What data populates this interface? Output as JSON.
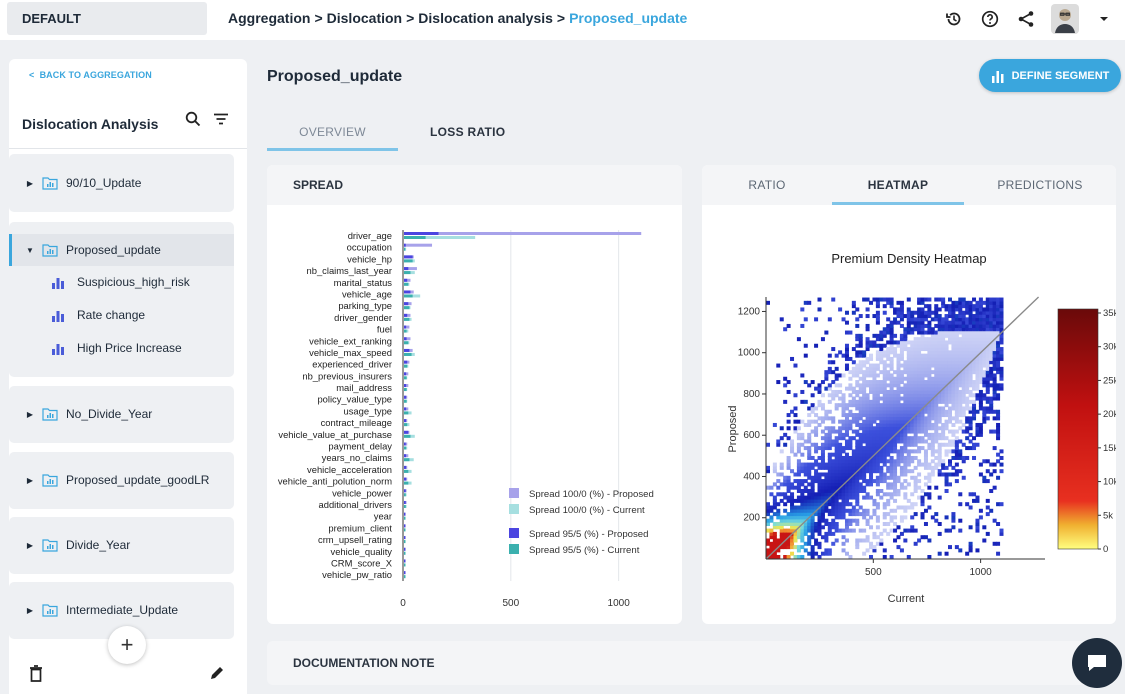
{
  "env": "DEFAULT",
  "breadcrumb": {
    "items": [
      "Aggregation",
      "Dislocation",
      "Dislocation analysis"
    ],
    "current": "Proposed_update",
    "separator": ">"
  },
  "icons": {
    "history": "history-icon",
    "help": "help-icon",
    "share": "share-icon",
    "avatar": "user-avatar",
    "menu": "chevron-down-icon"
  },
  "sidebar": {
    "back_label": "BACK TO AGGREGATION",
    "title": "Dislocation Analysis",
    "segments": [
      {
        "label": "90/10_Update"
      },
      {
        "label": "Proposed_update",
        "children": [
          "Suspicious_high_risk",
          "Rate change",
          "High Price Increase"
        ]
      },
      {
        "label": "No_Divide_Year"
      },
      {
        "label": "Proposed_update_goodLR"
      },
      {
        "label": "Divide_Year"
      },
      {
        "label": "Intermediate_Update"
      }
    ],
    "add_label": "+"
  },
  "main": {
    "title": "Proposed_update",
    "define_segment": "DEFINE SEGMENT",
    "tabs": [
      "OVERVIEW",
      "LOSS RATIO"
    ],
    "spread_title": "SPREAD",
    "right_tabs": [
      "RATIO",
      "HEATMAP",
      "PREDICTIONS"
    ],
    "doc_note": "DOCUMENTATION NOTE"
  },
  "colors": {
    "accent": "#3aa6dd",
    "p100": "#a7a2ea",
    "c100": "#a6dfe0",
    "p95": "#4b45e0",
    "c95": "#3bb0ae"
  },
  "chart_data": [
    {
      "type": "bar",
      "orientation": "horizontal",
      "title": "",
      "categories": [
        "driver_age",
        "occupation",
        "vehicle_hp",
        "nb_claims_last_year",
        "marital_status",
        "vehicle_age",
        "parking_type",
        "driver_gender",
        "fuel",
        "vehicle_ext_ranking",
        "vehicle_max_speed",
        "experienced_driver",
        "nb_previous_insurers",
        "mail_address",
        "policy_value_type",
        "usage_type",
        "contract_mileage",
        "vehicle_value_at_purchase",
        "payment_delay",
        "years_no_claims",
        "vehicle_acceleration",
        "vehicle_anti_polution_norm",
        "vehicle_power",
        "additional_drivers",
        "year",
        "premium_client",
        "crm_upsell_rating",
        "vehicle_quality",
        "CRM_score_X",
        "vehicle_pw_ratio"
      ],
      "series": [
        {
          "name": "Spread 100/0 (%) - Proposed",
          "values": [
            1100,
            130,
            45,
            60,
            30,
            45,
            35,
            30,
            25,
            30,
            40,
            25,
            20,
            20,
            15,
            20,
            15,
            25,
            15,
            20,
            15,
            15,
            12,
            12,
            8,
            8,
            8,
            8,
            8,
            8
          ]
        },
        {
          "name": "Spread 100/0 (%) - Current",
          "values": [
            330,
            10,
            50,
            50,
            25,
            75,
            30,
            35,
            20,
            25,
            50,
            20,
            15,
            15,
            15,
            35,
            25,
            50,
            15,
            45,
            35,
            35,
            12,
            12,
            8,
            8,
            8,
            8,
            8,
            8
          ]
        },
        {
          "name": "Spread 95/5 (%) - Proposed",
          "values": [
            160,
            8,
            40,
            20,
            15,
            30,
            20,
            15,
            10,
            12,
            25,
            15,
            10,
            10,
            10,
            10,
            10,
            20,
            8,
            10,
            10,
            10,
            8,
            8,
            6,
            6,
            6,
            6,
            6,
            6
          ]
        },
        {
          "name": "Spread 95/5 (%) - Current",
          "values": [
            100,
            6,
            40,
            30,
            20,
            40,
            25,
            25,
            12,
            20,
            35,
            15,
            12,
            12,
            12,
            20,
            15,
            30,
            10,
            25,
            20,
            20,
            8,
            8,
            6,
            6,
            6,
            6,
            6,
            6
          ]
        }
      ],
      "xlim": [
        0,
        1150
      ],
      "xticks": [
        0,
        500,
        1000
      ],
      "grid": true,
      "legend": "bottom-right"
    },
    {
      "type": "heatmap",
      "title": "Premium Density Heatmap",
      "xlabel": "Current",
      "ylabel": "Proposed",
      "xlim": [
        0,
        1300
      ],
      "ylim": [
        0,
        1270
      ],
      "xticks": [
        500,
        1000
      ],
      "yticks": [
        200,
        400,
        600,
        800,
        1000,
        1200
      ],
      "colorbar_ticks": [
        "35k",
        "30k",
        "25k",
        "20k",
        "15k",
        "10k",
        "5k",
        "0"
      ],
      "diagonal": true
    }
  ]
}
